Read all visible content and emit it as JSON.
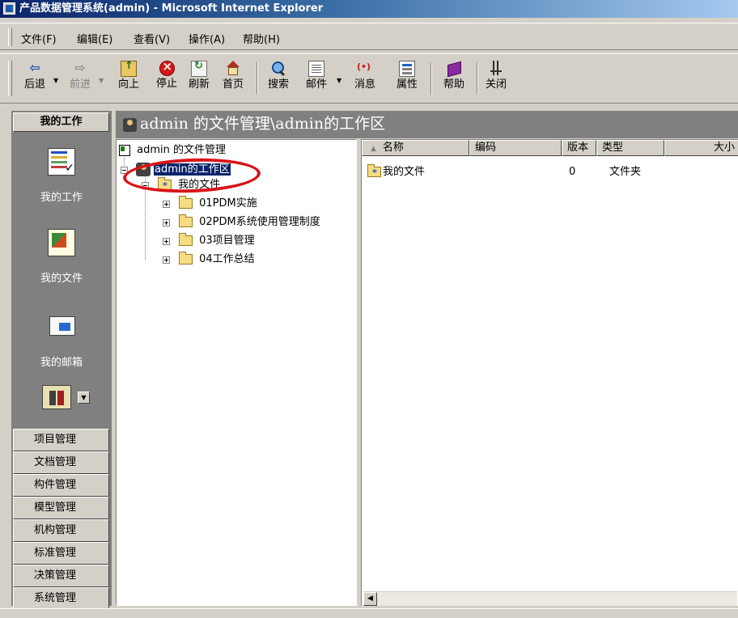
{
  "window": {
    "title": "产品数据管理系统(admin) - Microsoft Internet Explorer"
  },
  "menu": [
    "文件(F)",
    "编辑(E)",
    "查看(V)",
    "操作(A)",
    "帮助(H)"
  ],
  "toolbar": {
    "back": "后退",
    "forward": "前进",
    "up": "向上",
    "stop": "停止",
    "refresh": "刷新",
    "home": "首页",
    "search": "搜索",
    "mail": "邮件",
    "message": "消息",
    "properties": "属性",
    "help": "帮助",
    "close": "关闭"
  },
  "sidebar": {
    "header": "我的工作",
    "items": [
      {
        "label": "我的工作",
        "icon": "work-list-icon"
      },
      {
        "label": "我的文件",
        "icon": "files-icon"
      },
      {
        "label": "我的邮箱",
        "icon": "mailbox-icon"
      }
    ],
    "categories": [
      "项目管理",
      "文档管理",
      "构件管理",
      "模型管理",
      "机构管理",
      "标准管理",
      "决策管理",
      "系统管理"
    ]
  },
  "path": "admin 的文件管理\\admin的工作区",
  "tree": {
    "root": "admin 的文件管理",
    "workspace": "admin的工作区",
    "my_files": "我的文件",
    "folders": [
      "01PDM实施",
      "02PDM系统使用管理制度",
      "03项目管理",
      "04工作总结"
    ]
  },
  "list": {
    "columns": [
      "名称",
      "编码",
      "版本",
      "类型",
      "大小"
    ],
    "rows": [
      {
        "name": "我的文件",
        "code": "",
        "version": "0",
        "type": "文件夹",
        "size": ""
      }
    ]
  },
  "colors": {
    "title_start": "#0a246a",
    "title_end": "#a6caf0",
    "selection": "#0a246a",
    "annotation": "#d8141a",
    "chrome": "#d4d0c8",
    "panel_dark": "#808080"
  }
}
